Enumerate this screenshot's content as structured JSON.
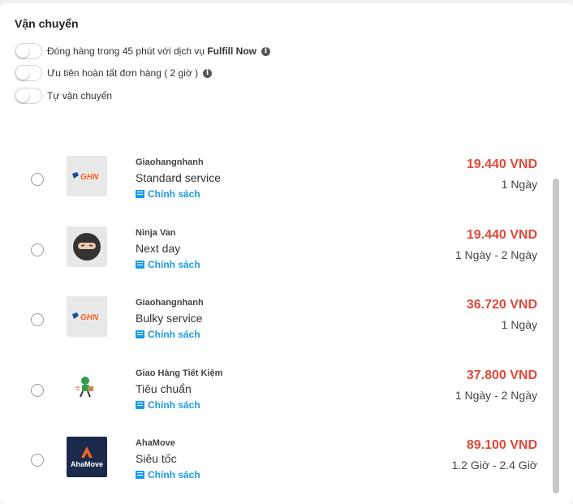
{
  "section": {
    "title": "Vận chuyển"
  },
  "toggles": [
    {
      "label": "Đóng hàng trong 45 phút với dịch vụ ",
      "bold": "Fulfill Now",
      "info": true
    },
    {
      "label": "Ưu tiên hoàn tất đơn hàng ( 2 giờ )",
      "bold": "",
      "info": true
    },
    {
      "label": "Tự vận chuyển",
      "bold": "",
      "info": false
    }
  ],
  "shipping_options": [
    {
      "carrier": "Giaohangnhanh",
      "service": "Standard service",
      "policy_label": "Chính sách",
      "price": "19.440 VND",
      "delivery_time": "1 Ngày",
      "logo_text": "GHN"
    },
    {
      "carrier": "Ninja Van",
      "service": "Next day",
      "policy_label": "Chính sách",
      "price": "19.440 VND",
      "delivery_time": "1 Ngày - 2 Ngày",
      "logo_text": ""
    },
    {
      "carrier": "Giaohangnhanh",
      "service": "Bulky service",
      "policy_label": "Chính sách",
      "price": "36.720 VND",
      "delivery_time": "1 Ngày",
      "logo_text": "GHN"
    },
    {
      "carrier": "Giao Hàng Tiết Kiệm",
      "service": "Tiêu chuẩn",
      "policy_label": "Chính sách",
      "price": "37.800 VND",
      "delivery_time": "1 Ngày - 2 Ngày",
      "logo_text": ""
    },
    {
      "carrier": "AhaMove",
      "service": "Siêu tốc",
      "policy_label": "Chính sách",
      "price": "89.100 VND",
      "delivery_time": "1.2 Giờ - 2.4 Giờ",
      "logo_text": "AhaMove"
    }
  ],
  "colors": {
    "price": "#e04a3a",
    "link": "#1a9be8",
    "ghn_orange": "#f26522",
    "aha_navy": "#1b2a4a"
  }
}
